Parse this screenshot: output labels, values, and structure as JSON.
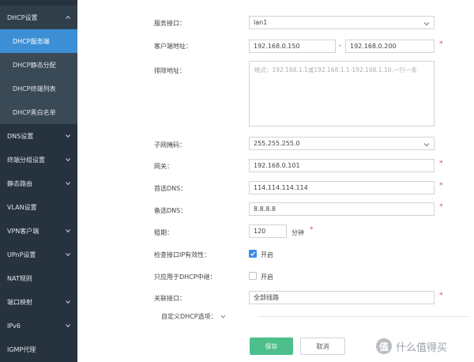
{
  "sidebar": {
    "group_title": "DHCP设置",
    "sub_items": [
      "DHCP服务端",
      "DHCP静态分配",
      "DHCP终端列表",
      "DHCP黑白名单"
    ],
    "active_sub": "DHCP服务端",
    "items": [
      {
        "label": "DNS设置",
        "chevron": true
      },
      {
        "label": "终端分组设置",
        "chevron": true
      },
      {
        "label": "静态路由",
        "chevron": true
      },
      {
        "label": "VLAN设置",
        "chevron": false
      },
      {
        "label": "VPN客户端",
        "chevron": true
      },
      {
        "label": "UPnP设置",
        "chevron": true
      },
      {
        "label": "NAT规则",
        "chevron": false
      },
      {
        "label": "端口映射",
        "chevron": true
      },
      {
        "label": "IPv6",
        "chevron": true
      },
      {
        "label": "IGMP代理",
        "chevron": false
      }
    ]
  },
  "form": {
    "service_interface": {
      "label": "服务接口：",
      "value": "lan1"
    },
    "client_address": {
      "label": "客户端地址：",
      "start": "192.168.0.150",
      "separator": "-",
      "end": "192.168.0.200"
    },
    "exclude_address": {
      "label": "排除地址：",
      "placeholder": "格式：192.168.1.1或192.168.1.1-192.168.1.10,一行一条"
    },
    "subnet_mask": {
      "label": "子网掩码：",
      "value": "255.255.255.0"
    },
    "gateway": {
      "label": "网关：",
      "value": "192.168.0.101"
    },
    "primary_dns": {
      "label": "首选DNS：",
      "value": "114.114.114.114"
    },
    "secondary_dns": {
      "label": "备选DNS：",
      "value": "8.8.8.8"
    },
    "lease": {
      "label": "租期：",
      "value": "120",
      "unit": "分钟"
    },
    "check_ip": {
      "label": "检查接口IP有效性：",
      "text": "开启",
      "checked": true
    },
    "relay_only": {
      "label": "只应用于DHCP中继：",
      "text": "开启",
      "checked": false
    },
    "bind_interface": {
      "label": "关联接口：",
      "value": "全部线路"
    },
    "custom_options": {
      "label": "自定义DHCP选项："
    },
    "required_mark": "*"
  },
  "buttons": {
    "save": "保存",
    "cancel": "取消"
  },
  "watermark": {
    "badge": "值",
    "text": "什么值得买"
  },
  "colors": {
    "sidebar_bg": "#26333f",
    "active": "#3c8fd4",
    "primary_button": "#4cbf8b",
    "required": "#e04a4a",
    "checkbox": "#3a8ee6"
  }
}
